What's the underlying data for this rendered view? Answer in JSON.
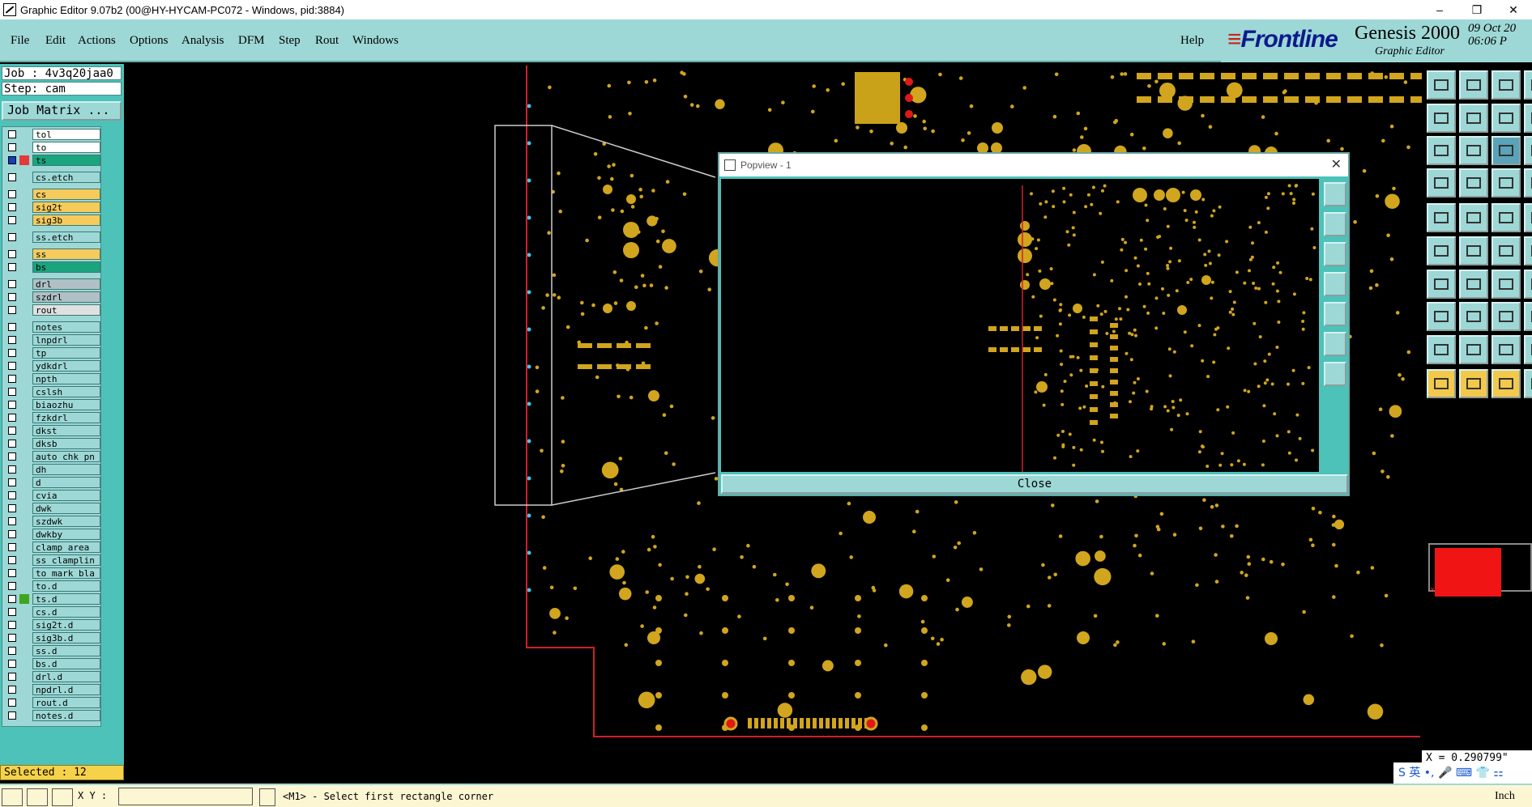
{
  "window": {
    "title": "Graphic Editor 9.07b2 (00@HY-HYCAM-PC072 - Windows, pid:3884)",
    "controls": [
      "–",
      "❐",
      "✕"
    ]
  },
  "menu": {
    "items": [
      {
        "label": "File"
      },
      {
        "label": "Edit"
      },
      {
        "label": "Actions"
      },
      {
        "label": "Options"
      },
      {
        "label": "Analysis"
      },
      {
        "label": "DFM"
      },
      {
        "label": "Step"
      },
      {
        "label": "Rout"
      },
      {
        "label": "Windows"
      }
    ],
    "help": "Help"
  },
  "brand": {
    "logo": "Frontline",
    "product": "Genesis 2000",
    "subtitle": "Graphic Editor",
    "date": "09 Oct 20",
    "time": "06:06 P"
  },
  "job": {
    "job_label": "Job : 4v3q20jaa0",
    "step_label": "Step: cam",
    "matrix_button": "Job Matrix ..."
  },
  "layers": [
    {
      "name": "tol",
      "color": "#ffffff"
    },
    {
      "name": "to",
      "color": "#ffffff"
    },
    {
      "name": "ts",
      "color": "#1aa57e",
      "active": true
    },
    {
      "name": "cs.etch",
      "color": "#9dd8d6"
    },
    {
      "name": "cs",
      "color": "#f6cb5b"
    },
    {
      "name": "sig2t",
      "color": "#f6cb5b"
    },
    {
      "name": "sig3b",
      "color": "#f6cb5b"
    },
    {
      "name": "ss.etch",
      "color": "#9dd8d6"
    },
    {
      "name": "ss",
      "color": "#f6cb5b"
    },
    {
      "name": "bs",
      "color": "#1aa57e"
    },
    {
      "name": "drl",
      "color": "#b0c0c4"
    },
    {
      "name": "szdrl",
      "color": "#b0c0c4"
    },
    {
      "name": "rout",
      "color": "#e0e0e0"
    },
    {
      "name": "notes",
      "color": "#9dd8d6"
    },
    {
      "name": "lnpdrl",
      "color": "#9dd8d6"
    },
    {
      "name": "tp",
      "color": "#9dd8d6"
    },
    {
      "name": "ydkdrl",
      "color": "#9dd8d6"
    },
    {
      "name": "npth",
      "color": "#9dd8d6"
    },
    {
      "name": "cslsh",
      "color": "#9dd8d6"
    },
    {
      "name": "biaozhu",
      "color": "#9dd8d6"
    },
    {
      "name": "fzkdrl",
      "color": "#9dd8d6"
    },
    {
      "name": "dkst",
      "color": "#9dd8d6"
    },
    {
      "name": "dksb",
      "color": "#9dd8d6"
    },
    {
      "name": "auto_chk_pn",
      "color": "#9dd8d6"
    },
    {
      "name": "dh",
      "color": "#9dd8d6"
    },
    {
      "name": "d",
      "color": "#9dd8d6"
    },
    {
      "name": "cvia",
      "color": "#9dd8d6"
    },
    {
      "name": "dwk",
      "color": "#9dd8d6"
    },
    {
      "name": "szdwk",
      "color": "#9dd8d6"
    },
    {
      "name": "dwkby",
      "color": "#9dd8d6"
    },
    {
      "name": "clamp_area",
      "color": "#9dd8d6"
    },
    {
      "name": "ss_clamplin",
      "color": "#9dd8d6"
    },
    {
      "name": "to_mark_bla",
      "color": "#9dd8d6"
    },
    {
      "name": "to.d",
      "color": "#9dd8d6"
    },
    {
      "name": "ts.d",
      "color": "#9dd8d6",
      "affected": true
    },
    {
      "name": "cs.d",
      "color": "#9dd8d6"
    },
    {
      "name": "sig2t.d",
      "color": "#9dd8d6"
    },
    {
      "name": "sig3b.d",
      "color": "#9dd8d6"
    },
    {
      "name": "ss.d",
      "color": "#9dd8d6"
    },
    {
      "name": "bs.d",
      "color": "#9dd8d6"
    },
    {
      "name": "drl.d",
      "color": "#9dd8d6"
    },
    {
      "name": "npdrl.d",
      "color": "#9dd8d6"
    },
    {
      "name": "rout.d",
      "color": "#9dd8d6"
    },
    {
      "name": "notes.d",
      "color": "#9dd8d6"
    }
  ],
  "selected": "Selected : 12",
  "popview": {
    "title": "Popview - 1",
    "close_label": "Close"
  },
  "status": {
    "xy_label": "X Y :",
    "xy_value": "",
    "message": "<M1> - Select first rectangle corner",
    "units": "Inch"
  },
  "coords": {
    "x": "X = 0.290799\""
  },
  "colors": {
    "panel": "#9dd8d6",
    "panel_dark": "#4cc2b9",
    "pad": "#d1a51e",
    "outline": "#d0202a",
    "highlight": "#f3c94c"
  }
}
